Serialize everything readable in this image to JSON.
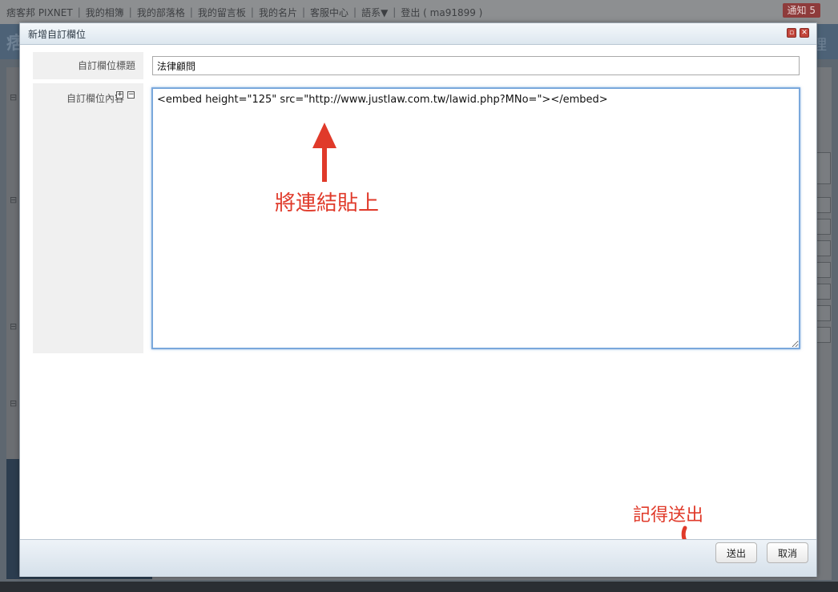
{
  "background": {
    "topbar_items": [
      "痞客邦 PIXNET",
      "我的相簿",
      "我的部落格",
      "我的留言板",
      "我的名片",
      "客服中心",
      "語系▼",
      "登出 ( ma91899 )"
    ],
    "notify_label": "通知 5",
    "header_logo": "痞",
    "header_right": "理"
  },
  "modal": {
    "title": "新增自訂欄位",
    "fields": {
      "title_label": "自訂欄位標題",
      "title_value": "法律顧問",
      "content_label": "自訂欄位內容",
      "content_value": "<embed height=\"125\" src=\"http://www.justlaw.com.tw/lawid.php?MNo=\"></embed>"
    },
    "expand_symbol": "+",
    "collapse_symbol": "−",
    "buttons": {
      "submit": "送出",
      "cancel": "取消"
    }
  },
  "annotations": {
    "paste_hint": "將連結貼上",
    "submit_hint": "記得送出",
    "color": "#e03a2a"
  }
}
